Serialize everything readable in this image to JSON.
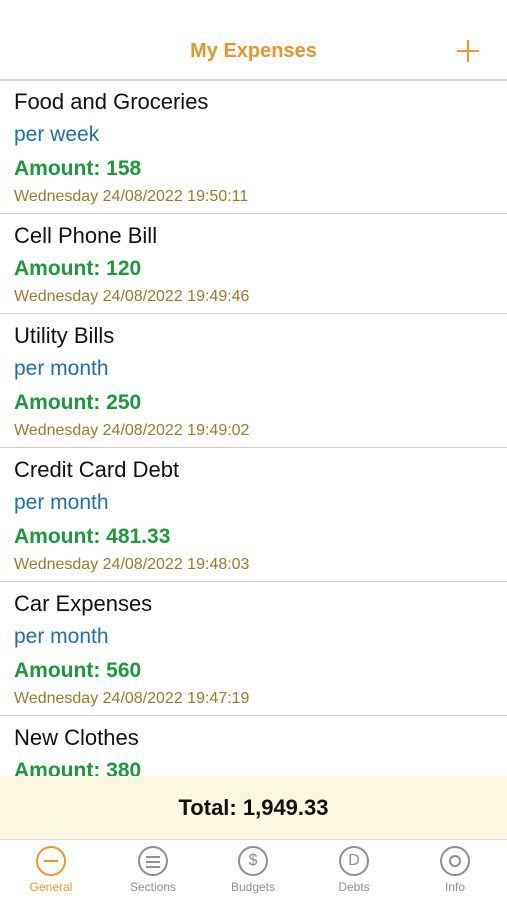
{
  "header": {
    "title": "My Expenses",
    "add_icon": "plus-icon"
  },
  "expenses": [
    {
      "title": "Food and Groceries",
      "frequency": "per week",
      "amount": "Amount: 158",
      "date": "Wednesday 24/08/2022 19:50:11"
    },
    {
      "title": "Cell Phone Bill",
      "frequency": "",
      "amount": "Amount: 120",
      "date": "Wednesday 24/08/2022 19:49:46"
    },
    {
      "title": "Utility Bills",
      "frequency": "per month",
      "amount": "Amount: 250",
      "date": "Wednesday 24/08/2022 19:49:02"
    },
    {
      "title": "Credit Card Debt",
      "frequency": "per month",
      "amount": "Amount: 481.33",
      "date": "Wednesday 24/08/2022 19:48:03"
    },
    {
      "title": "Car Expenses",
      "frequency": "per month",
      "amount": "Amount: 560",
      "date": "Wednesday 24/08/2022 19:47:19"
    },
    {
      "title": "New Clothes",
      "frequency": "",
      "amount": "Amount: 380",
      "date": ""
    }
  ],
  "total": "Total: 1,949.33",
  "tabs": [
    {
      "label": "General",
      "icon": "minus-circle-icon",
      "active": true
    },
    {
      "label": "Sections",
      "icon": "list-circle-icon",
      "active": false
    },
    {
      "label": "Budgets",
      "icon": "dollar-circle-icon",
      "active": false
    },
    {
      "label": "Debts",
      "icon": "d-circle-icon",
      "active": false
    },
    {
      "label": "Info",
      "icon": "gear-icon",
      "active": false
    }
  ],
  "colors": {
    "accent": "#f0962a",
    "frequency": "#1f6fa8",
    "amount": "#1b9a3b",
    "date": "#9b7a2a",
    "total_bg": "#fbf7e0"
  }
}
